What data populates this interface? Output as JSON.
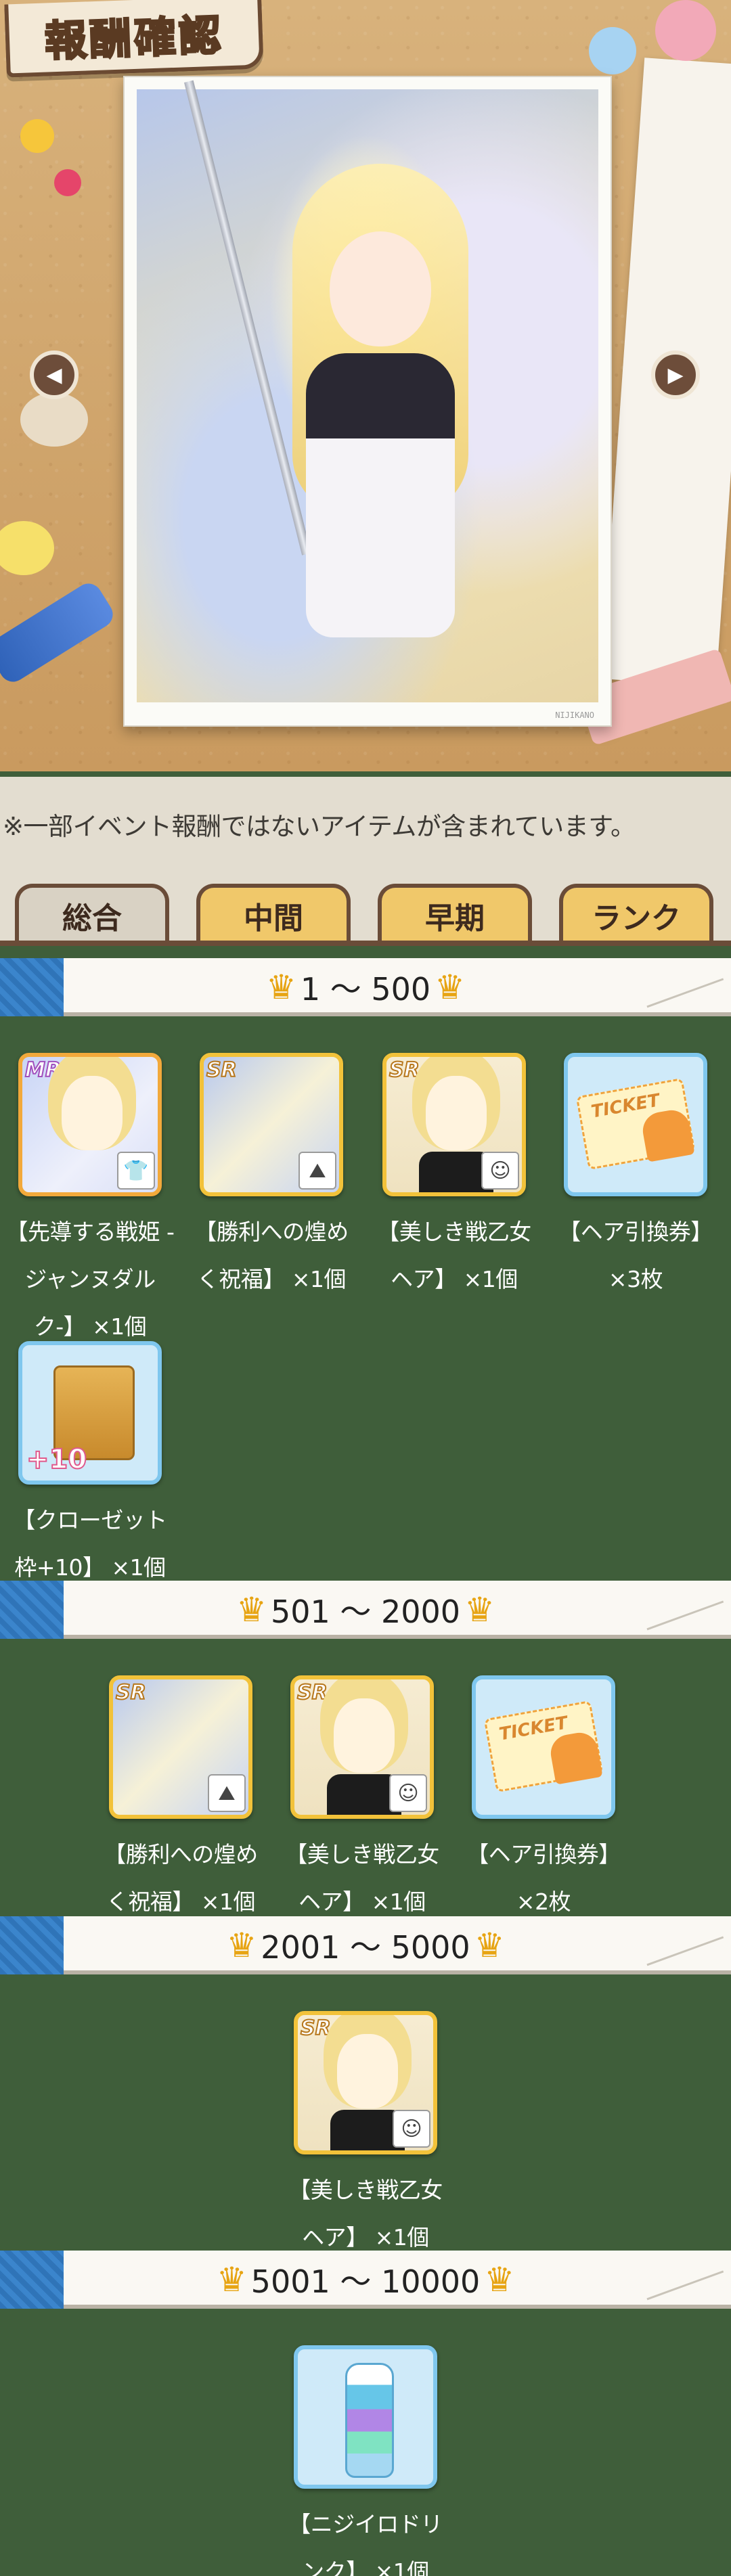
{
  "header": {
    "title": "報酬確認",
    "photo_caption": "NIJIKANO"
  },
  "notice": "※一部イベント報酬ではないアイテムが含まれています。",
  "tabs": [
    {
      "label": "総合",
      "active": true
    },
    {
      "label": "中間",
      "active": false
    },
    {
      "label": "早期",
      "active": false
    },
    {
      "label": "ランク",
      "active": false
    }
  ],
  "tiers": [
    {
      "range": "1 ～ 500",
      "items": [
        {
          "rank": "MR",
          "icon": "outfit-icon",
          "name": "【先導する戦姫 -ジャンヌダルク-】 ×1個"
        },
        {
          "rank": "SR",
          "icon": "background-icon",
          "name": "【勝利への煌めく祝福】 ×1個"
        },
        {
          "rank": "SR",
          "icon": "hair-icon",
          "name": "【美しき戦乙女ヘア】 ×1個"
        },
        {
          "rank": "",
          "icon": "ticket-icon",
          "name": "【ヘア引換券】 ×3枚"
        },
        {
          "rank": "",
          "icon": "closet-icon",
          "name": "【クローゼット枠+10】 ×1個"
        }
      ]
    },
    {
      "range": "501 ～ 2000",
      "items": [
        {
          "rank": "SR",
          "icon": "background-icon",
          "name": "【勝利への煌めく祝福】 ×1個"
        },
        {
          "rank": "SR",
          "icon": "hair-icon",
          "name": "【美しき戦乙女ヘア】 ×1個"
        },
        {
          "rank": "",
          "icon": "ticket-icon",
          "name": "【ヘア引換券】 ×2枚"
        }
      ]
    },
    {
      "range": "2001 ～ 5000",
      "items": [
        {
          "rank": "SR",
          "icon": "hair-icon",
          "name": "【美しき戦乙女ヘア】 ×1個"
        }
      ]
    },
    {
      "range": "5001 ～ 10000",
      "items": [
        {
          "rank": "",
          "icon": "drink-icon",
          "name": "【ニジイロドリンク】 ×1個"
        }
      ]
    }
  ],
  "badges": {
    "plus_ten": "+10",
    "ticket_word": "TICKET"
  },
  "colors": {
    "background": "#3f5e3a",
    "tab_active": "#d9d2c4",
    "tab_inactive": "#f0c86a",
    "crown": "#e7a413",
    "frame_gold": "#f2c23a",
    "frame_blue": "#7fc7ee"
  }
}
